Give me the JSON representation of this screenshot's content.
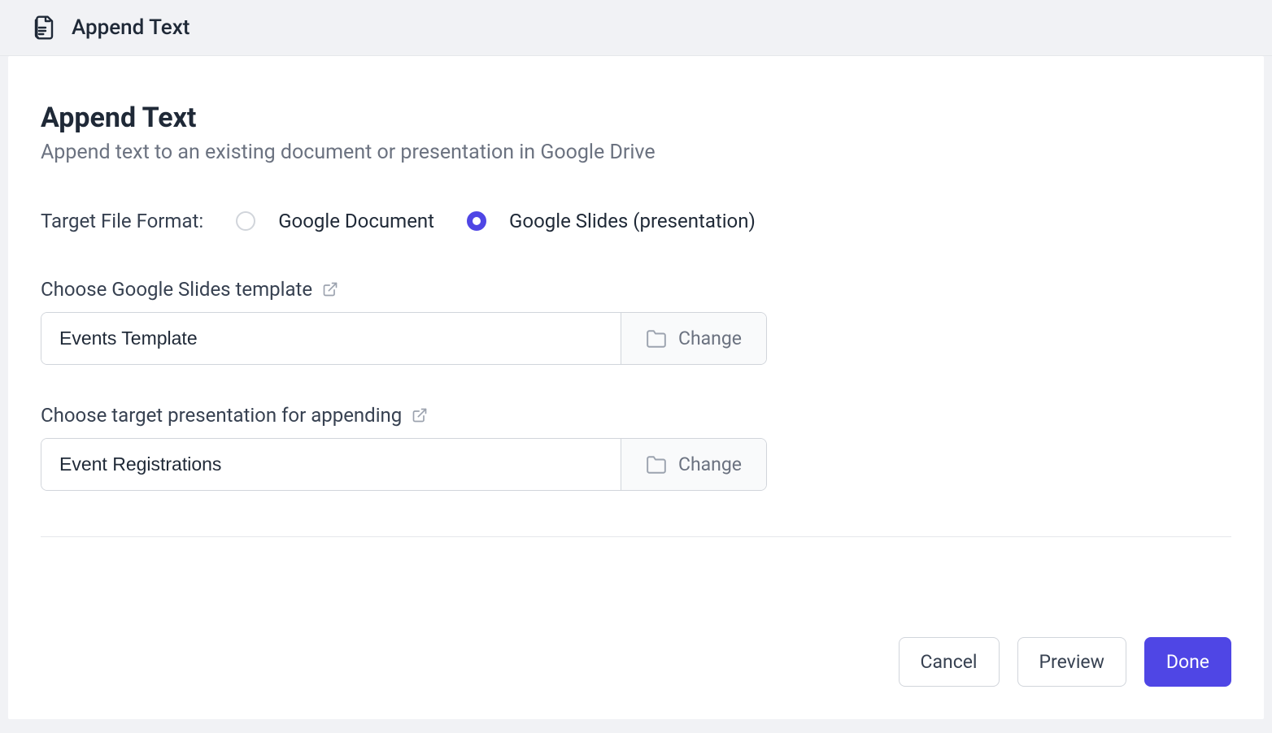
{
  "header": {
    "title": "Append Text"
  },
  "main": {
    "title": "Append Text",
    "subtitle": "Append text to an existing document or presentation in Google Drive"
  },
  "format": {
    "label": "Target File Format:",
    "options": {
      "doc": "Google Document",
      "slides": "Google Slides (presentation)"
    },
    "selected": "slides"
  },
  "template": {
    "label": "Choose Google Slides template",
    "value": "Events Template",
    "change_label": "Change"
  },
  "target": {
    "label": "Choose target presentation for appending",
    "value": "Event Registrations",
    "change_label": "Change"
  },
  "footer": {
    "cancel": "Cancel",
    "preview": "Preview",
    "done": "Done"
  }
}
